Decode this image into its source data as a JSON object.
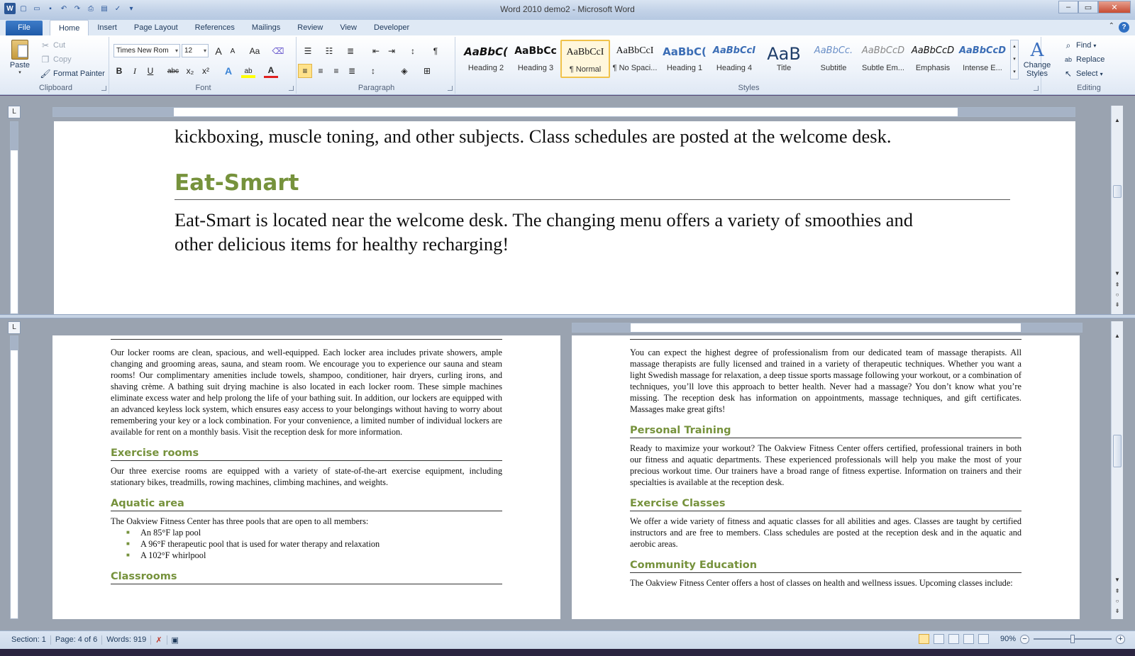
{
  "window": {
    "title": "Word 2010 demo2 - Microsoft Word",
    "minimize": "‒",
    "maximize": "▭",
    "close": "✕"
  },
  "tabs": {
    "file": "File",
    "items": [
      "Home",
      "Insert",
      "Page Layout",
      "References",
      "Mailings",
      "Review",
      "View",
      "Developer"
    ],
    "active": "Home",
    "help": "?"
  },
  "clipboard": {
    "group_label": "Clipboard",
    "paste": "Paste",
    "cut": "Cut",
    "copy": "Copy",
    "format_painter": "Format Painter"
  },
  "font": {
    "group_label": "Font",
    "family": "Times New Rom",
    "size": "12",
    "grow": "A",
    "shrink": "A",
    "change_case": "Aa",
    "bold": "B",
    "italic": "I",
    "underline": "U",
    "strike": "abc",
    "subscript": "x₂",
    "superscript": "x²",
    "text_effects": "A",
    "highlight": "ab",
    "font_color": "A"
  },
  "paragraph": {
    "group_label": "Paragraph",
    "show_marks": "¶"
  },
  "styles": {
    "group_label": "Styles",
    "items": [
      {
        "sample": "AaBbC(",
        "name": "Heading 2"
      },
      {
        "sample": "AaBbCc",
        "name": "Heading 3"
      },
      {
        "sample": "AaBbCcI",
        "name": "¶ Normal"
      },
      {
        "sample": "AaBbCcI",
        "name": "¶ No Spaci..."
      },
      {
        "sample": "AaBbC(",
        "name": "Heading 1"
      },
      {
        "sample": "AaBbCcI",
        "name": "Heading 4"
      },
      {
        "sample": "AaB",
        "name": "Title"
      },
      {
        "sample": "AaBbCc.",
        "name": "Subtitle"
      },
      {
        "sample": "AaBbCcD",
        "name": "Subtle Em..."
      },
      {
        "sample": "AaBbCcD",
        "name": "Emphasis"
      },
      {
        "sample": "AaBbCcD",
        "name": "Intense E..."
      }
    ],
    "selected_index": 2,
    "change_styles": "Change Styles"
  },
  "editing": {
    "group_label": "Editing",
    "find": "Find",
    "replace": "Replace",
    "select": "Select"
  },
  "top_pane": {
    "line_top": "kickboxing, muscle toning, and other subjects. Class schedules are posted at the welcome desk.",
    "heading": "Eat-Smart",
    "paragraph": "Eat-Smart is located near the welcome desk. The changing menu offers a variety of smoothies and other delicious items for healthy recharging!"
  },
  "left_page": {
    "locker_text": "Our locker rooms are clean, spacious, and well-equipped. Each locker area includes private showers, ample changing and grooming areas, sauna, and steam room. We encourage you to experience our sauna and steam rooms! Our complimentary amenities include towels, shampoo, conditioner, hair dryers, curling irons, and shaving crème. A bathing suit drying machine is also located in each locker room. These simple machines eliminate excess water and help prolong the life of your bathing suit. In addition, our lockers are equipped with an advanced keyless lock system, which ensures easy access to your belongings without having to worry about remembering your key or a lock combination. For your convenience, a limited number of individual lockers are available for rent on a monthly basis. Visit the reception desk for more information.",
    "exercise_heading": "Exercise rooms",
    "exercise_text": "Our three exercise rooms are equipped with a variety of state-of-the-art exercise equipment, including stationary bikes, treadmills, rowing machines, climbing machines, and weights.",
    "aquatic_heading": "Aquatic area",
    "aquatic_text": "The Oakview Fitness Center has three pools that are open to all members:",
    "aquatic_items": [
      "An 85°F lap pool",
      "A 96°F therapeutic pool that is used for water therapy and relaxation",
      "A 102°F whirlpool"
    ],
    "classrooms_heading": "Classrooms"
  },
  "right_page": {
    "massage_text": "You can expect the highest degree of professionalism from our dedicated team of massage therapists. All massage therapists are fully licensed and trained in a variety of therapeutic techniques. Whether you want a light Swedish massage for relaxation, a deep tissue sports massage following your workout, or a combination of techniques, you’ll love this approach to better health. Never had a massage? You don’t know what you’re missing. The reception desk has information on appointments, massage techniques, and gift certificates. Massages make great gifts!",
    "training_heading": "Personal Training",
    "training_text": "Ready to maximize your workout? The Oakview Fitness Center offers certified, professional trainers in both our fitness and aquatic departments. These experienced professionals will help you make the most of your precious workout time. Our trainers have a broad range of fitness expertise. Information on trainers and their specialties is available at the reception desk.",
    "classes_heading": "Exercise Classes",
    "classes_text": "We offer a wide variety of fitness and aquatic classes for all abilities and ages. Classes are taught by certified instructors and are free to members. Class schedules are posted at the reception desk and in the aquatic and aerobic areas.",
    "community_heading": "Community Education",
    "community_text": "The Oakview Fitness Center offers a host of classes on health and wellness issues. Upcoming classes include:"
  },
  "status": {
    "section": "Section: 1",
    "page": "Page: 4 of 6",
    "words": "Words: 919",
    "zoom": "90%",
    "zoom_out": "−",
    "zoom_in": "+"
  }
}
